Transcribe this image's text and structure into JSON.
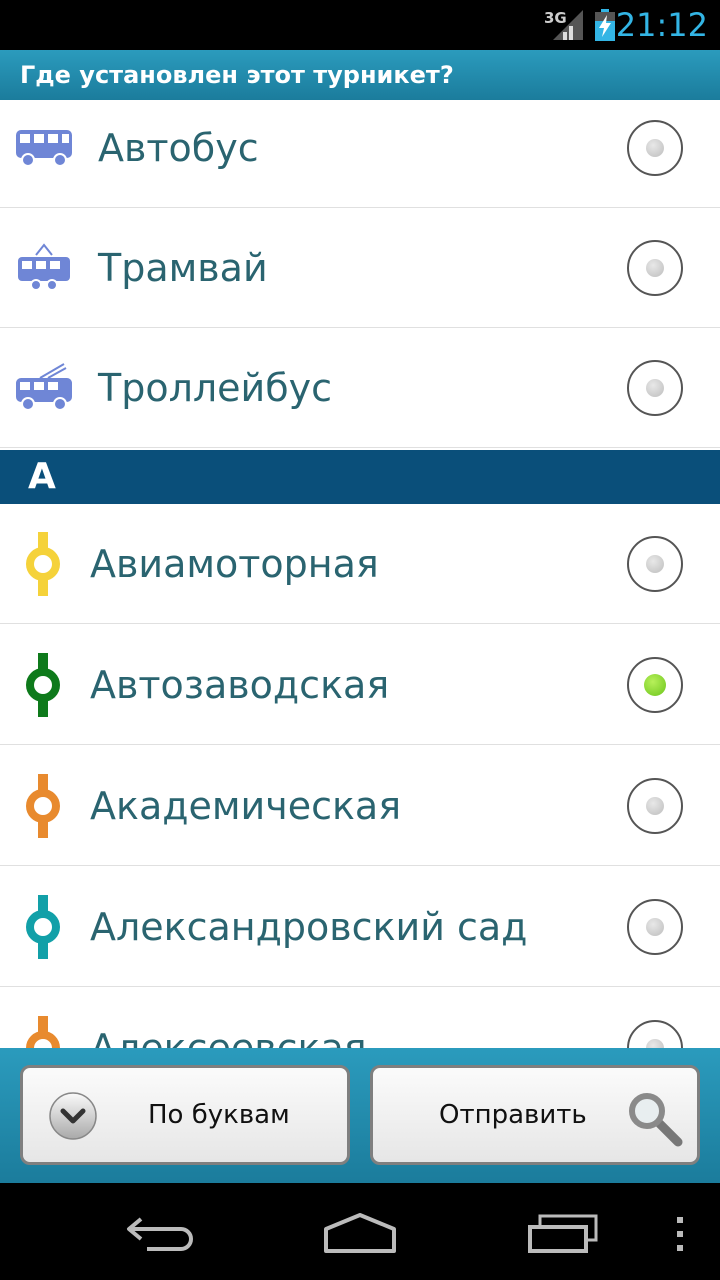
{
  "status_bar": {
    "network": "3G",
    "time": "21:12"
  },
  "title": "Где установлен этот турникет?",
  "transport_items": [
    {
      "label": "Автобус",
      "icon": "bus-icon",
      "checked": false
    },
    {
      "label": "Трамвай",
      "icon": "tram-icon",
      "checked": false
    },
    {
      "label": "Троллейбус",
      "icon": "trolleybus-icon",
      "checked": false
    }
  ],
  "section_letter": "А",
  "stations": [
    {
      "label": "Авиамоторная",
      "icon": "metro-station-icon",
      "color": "#f5d23a",
      "checked": false
    },
    {
      "label": "Автозаводская",
      "icon": "metro-station-icon",
      "color": "#0e7a1b",
      "checked": true
    },
    {
      "label": "Академическая",
      "icon": "metro-station-icon",
      "color": "#e88a2e",
      "checked": false
    },
    {
      "label": "Александровский сад",
      "icon": "metro-station-icon",
      "color": "#12a0a8",
      "checked": false
    },
    {
      "label": "Алексеевская",
      "icon": "metro-station-icon",
      "color": "#e88a2e",
      "checked": false
    }
  ],
  "colors": {
    "transport_icon": "#6f86d6",
    "label_text": "#2a6470",
    "header_bg": "#0a4f7a",
    "accent": "#33b5e5"
  },
  "buttons": {
    "by_letters": {
      "label": "По буквам",
      "icon": "chevron-down-icon"
    },
    "submit": {
      "label": "Отправить",
      "icon": "search-icon"
    }
  },
  "nav": {
    "back": "back-icon",
    "home": "home-icon",
    "recent": "recent-apps-icon",
    "menu": "overflow-menu-icon"
  }
}
